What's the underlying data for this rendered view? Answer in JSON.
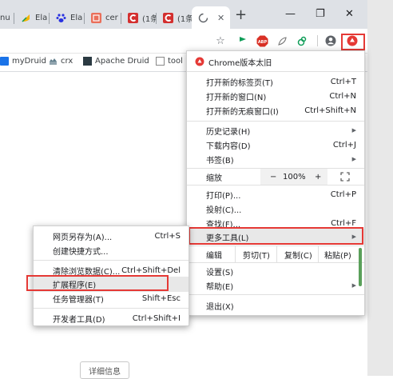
{
  "tabs": [
    {
      "label": "nu",
      "icon": "generic-page-icon",
      "color": "#4285f4"
    },
    {
      "label": "Ela",
      "icon": "yellow-leaf-icon",
      "color": "#f4b400"
    },
    {
      "label": "Ela",
      "icon": "baidu-paw-icon",
      "color": "#2932e1"
    },
    {
      "label": "cer",
      "icon": "jianshu-icon",
      "color": "#ea6f5a"
    },
    {
      "label": "(1条",
      "icon": "red-c-icon",
      "color": "#d32f2f"
    },
    {
      "label": "(1条",
      "icon": "red-c-icon",
      "color": "#d32f2f"
    },
    {
      "label": "",
      "icon": "loading-icon",
      "color": "#5f6368"
    }
  ],
  "new_tab": "+",
  "window_controls": {
    "minimize": "—",
    "restore": "❐",
    "close": "✕"
  },
  "bookmarks": [
    {
      "label": "myDruid"
    },
    {
      "label": "crx"
    },
    {
      "label": "Apache Druid"
    },
    {
      "label": "tool"
    }
  ],
  "main_menu": {
    "header": "Chrome版本太旧",
    "items": {
      "new_tab": {
        "label": "打开新的标签页(T)",
        "shortcut": "Ctrl+T"
      },
      "new_window": {
        "label": "打开新的窗口(N)",
        "shortcut": "Ctrl+N"
      },
      "new_incognito": {
        "label": "打开新的无痕窗口(I)",
        "shortcut": "Ctrl+Shift+N"
      },
      "history": {
        "label": "历史记录(H)"
      },
      "downloads": {
        "label": "下载内容(D)",
        "shortcut": "Ctrl+J"
      },
      "bookmarks": {
        "label": "书签(B)"
      },
      "zoom": {
        "label": "缩放",
        "minus": "−",
        "value": "100%",
        "plus": "+"
      },
      "print": {
        "label": "打印(P)...",
        "shortcut": "Ctrl+P"
      },
      "cast": {
        "label": "投射(C)..."
      },
      "find": {
        "label": "查找(F)...",
        "shortcut": "Ctrl+F"
      },
      "more_tools": {
        "label": "更多工具(L)"
      },
      "edit": {
        "label": "编辑",
        "cut": "剪切(T)",
        "copy": "复制(C)",
        "paste": "粘贴(P)"
      },
      "settings": {
        "label": "设置(S)"
      },
      "help": {
        "label": "帮助(E)"
      },
      "exit": {
        "label": "退出(X)"
      }
    }
  },
  "sub_menu": {
    "save_page": {
      "label": "网页另存为(A)...",
      "shortcut": "Ctrl+S"
    },
    "create_shortcut": {
      "label": "创建快捷方式..."
    },
    "clear_data": {
      "label": "清除浏览数据(C)...",
      "shortcut": "Ctrl+Shift+Del"
    },
    "extensions": {
      "label": "扩展程序(E)"
    },
    "task_manager": {
      "label": "任务管理器(T)",
      "shortcut": "Shift+Esc"
    },
    "dev_tools": {
      "label": "开发者工具(D)",
      "shortcut": "Ctrl+Shift+I"
    }
  },
  "page": {
    "detail_button": "详细信息"
  },
  "colors": {
    "highlight_red": "#e53935",
    "menu_hover": "#e8e8e8"
  }
}
